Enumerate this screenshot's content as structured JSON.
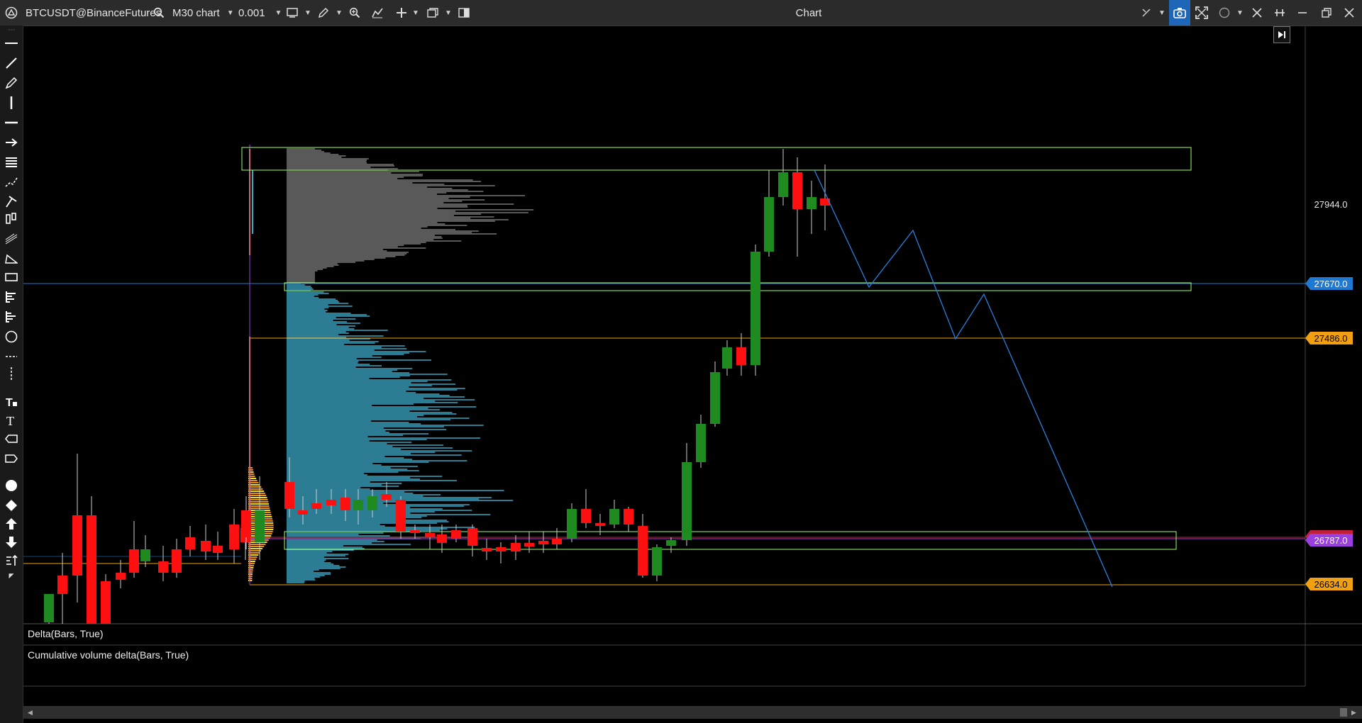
{
  "window": {
    "symbol": "BTCUSDT@BinanceFutures",
    "timeframe": "M30 chart",
    "tick_size": "0.001",
    "title": "Chart"
  },
  "toolbar_icons": [
    "line-tool-icon",
    "trend-line-icon",
    "pencil-icon",
    "vertical-line-icon",
    "horizontal-line-icon",
    "arrow-icon",
    "fib-icon",
    "path-icon",
    "pitchfork-icon",
    "channel-icon",
    "triangle-icon",
    "rectangle-icon",
    "profile-icon",
    "volume-profile-icon",
    "circle-icon",
    "ruler-icon",
    "text-icon",
    "text-t-icon",
    "label-icon",
    "price-label-icon",
    "dot-icon",
    "diamond-icon",
    "arrow-up-icon",
    "arrow-down-icon",
    "sort-icon"
  ],
  "price_axis": {
    "plain_label": "27944.0",
    "tags": [
      {
        "value": "27670.0",
        "color": "#1f78d1"
      },
      {
        "value": "27486.0",
        "color": "#f0a010"
      },
      {
        "value": "26788.0",
        "color": "#c0203c"
      },
      {
        "value": "26787.0",
        "color": "#9b40e0"
      },
      {
        "value": "26634.0",
        "color": "#f0a010"
      }
    ]
  },
  "panes": {
    "delta": "Delta(Bars, True)",
    "cvd": "Cumulative volume delta(Bars, True)"
  },
  "colors": {
    "bull": "#1f8a1f",
    "bear": "#ff1010",
    "zone": "#9dff6a",
    "profile_upper": "#777777",
    "profile_lower": "#3aa6c4",
    "projection": "#2a7fe0"
  }
}
